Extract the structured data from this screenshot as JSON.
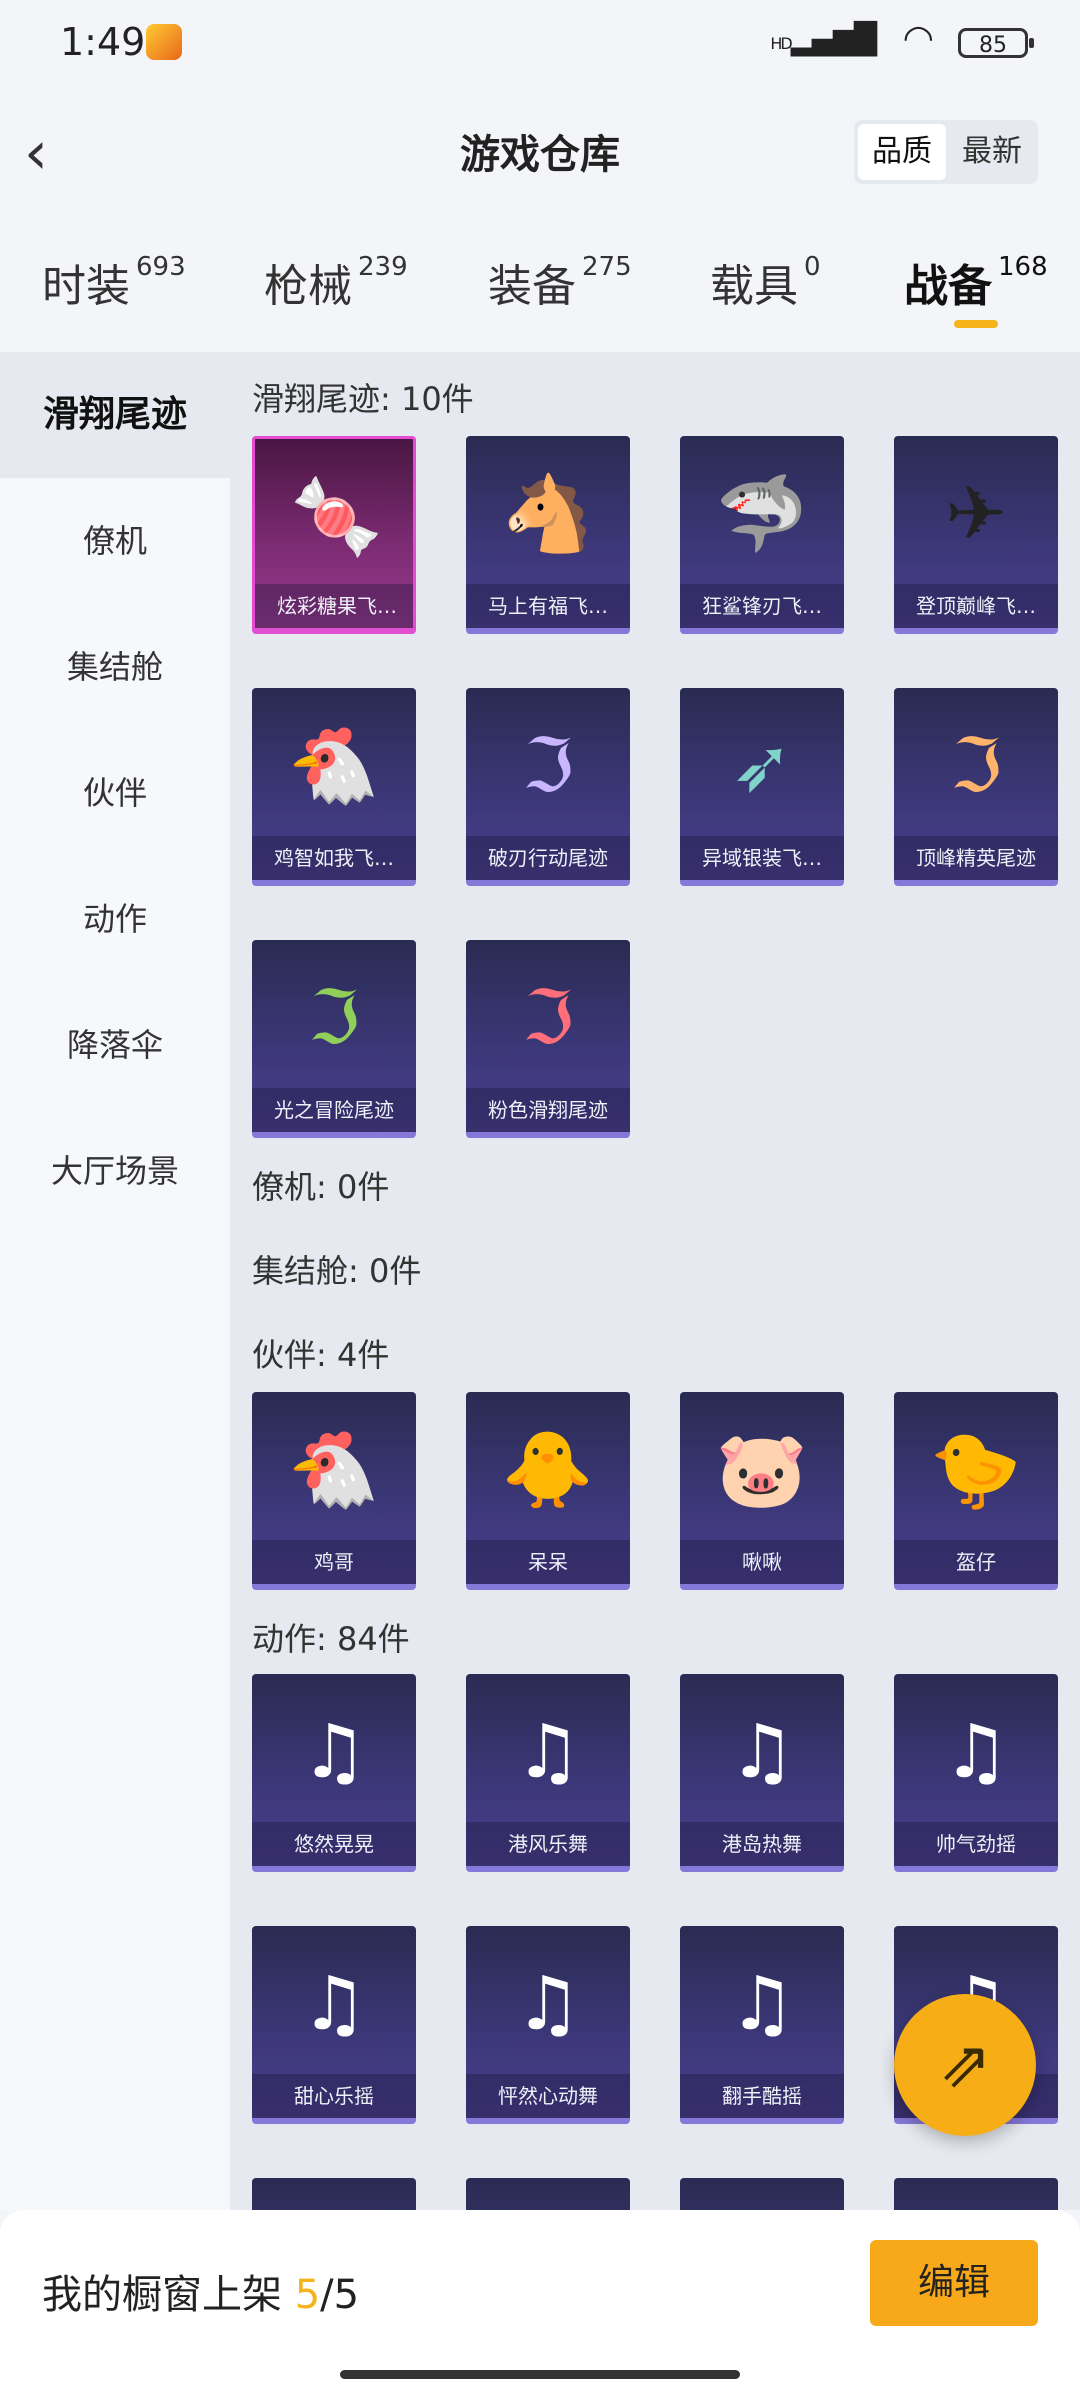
{
  "status": {
    "time": "1:49",
    "signal": "HD",
    "battery": "85"
  },
  "header": {
    "title": "游戏仓库",
    "sort": [
      "品质",
      "最新"
    ],
    "back_icon": "chevron-left-icon"
  },
  "tabs": [
    {
      "label": "时装",
      "count": "693"
    },
    {
      "label": "枪械",
      "count": "239"
    },
    {
      "label": "装备",
      "count": "275"
    },
    {
      "label": "载具",
      "count": "0"
    },
    {
      "label": "战备",
      "count": "168"
    }
  ],
  "sidebar": [
    "滑翔尾迹",
    "僚机",
    "集结舱",
    "伙伴",
    "动作",
    "降落伞",
    "大厅场景"
  ],
  "sections": {
    "trail": "滑翔尾迹: 10件",
    "wingman": "僚机: 0件",
    "pod": "集结舱: 0件",
    "partner": "伙伴: 4件",
    "emote": "动作: 84件"
  },
  "trail_items": [
    "炫彩糖果飞…",
    "马上有福飞…",
    "狂鲨锋刃飞…",
    "登顶巅峰飞…",
    "鸡智如我飞…",
    "破刃行动尾迹",
    "异域银装飞…",
    "顶峰精英尾迹",
    "光之冒险尾迹",
    "粉色滑翔尾迹"
  ],
  "partner_items": [
    "鸡哥",
    "呆呆",
    "啾啾",
    "盔仔"
  ],
  "emote_items": [
    "悠然晃晃",
    "港风乐舞",
    "港岛热舞",
    "帅气劲摇",
    "甜心乐摇",
    "怦然心动舞",
    "翻手酷摇",
    ""
  ],
  "bottom": {
    "prefix": "我的橱窗上架 ",
    "current": "5",
    "total": "/5",
    "edit": "编辑"
  },
  "colors": {
    "accent": "#f5b41c",
    "card": "#3b3777",
    "highlight_card": "#e44ad2"
  }
}
